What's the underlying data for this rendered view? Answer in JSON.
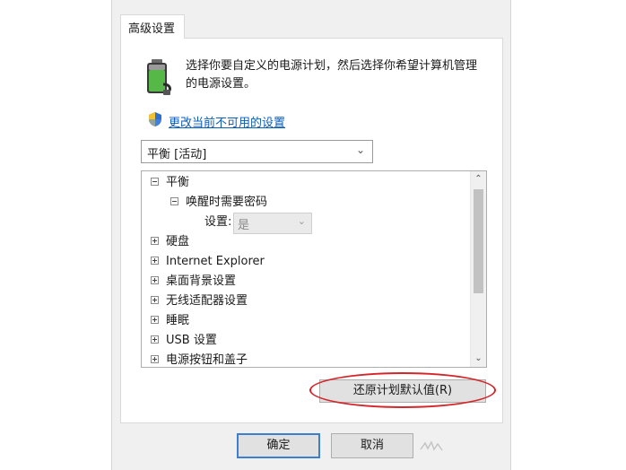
{
  "tab": {
    "label": "高级设置"
  },
  "description": {
    "line1": "选择你要自定义的电源计划，然后选择你希望计算机管理",
    "line2": "的电源设置。"
  },
  "change_link": {
    "label": "更改当前不可用的设置"
  },
  "plan_select": {
    "value": "平衡 [活动]"
  },
  "tree": {
    "root": "平衡",
    "child": "唤醒时需要密码",
    "setting_label": "设置:",
    "setting_value": "是",
    "items": [
      "硬盘",
      "Internet Explorer",
      "桌面背景设置",
      "无线适配器设置",
      "睡眠",
      "USB 设置",
      "电源按钮和盖子"
    ]
  },
  "buttons": {
    "restore": "还原计划默认值(R)",
    "ok": "确定",
    "cancel": "取消"
  },
  "icons": {
    "battery": "battery-power-icon",
    "shield": "uac-shield-icon"
  },
  "colors": {
    "link": "#0b5db8",
    "highlight_ellipse": "#d4262a",
    "focus_border": "#3c7fd0"
  }
}
